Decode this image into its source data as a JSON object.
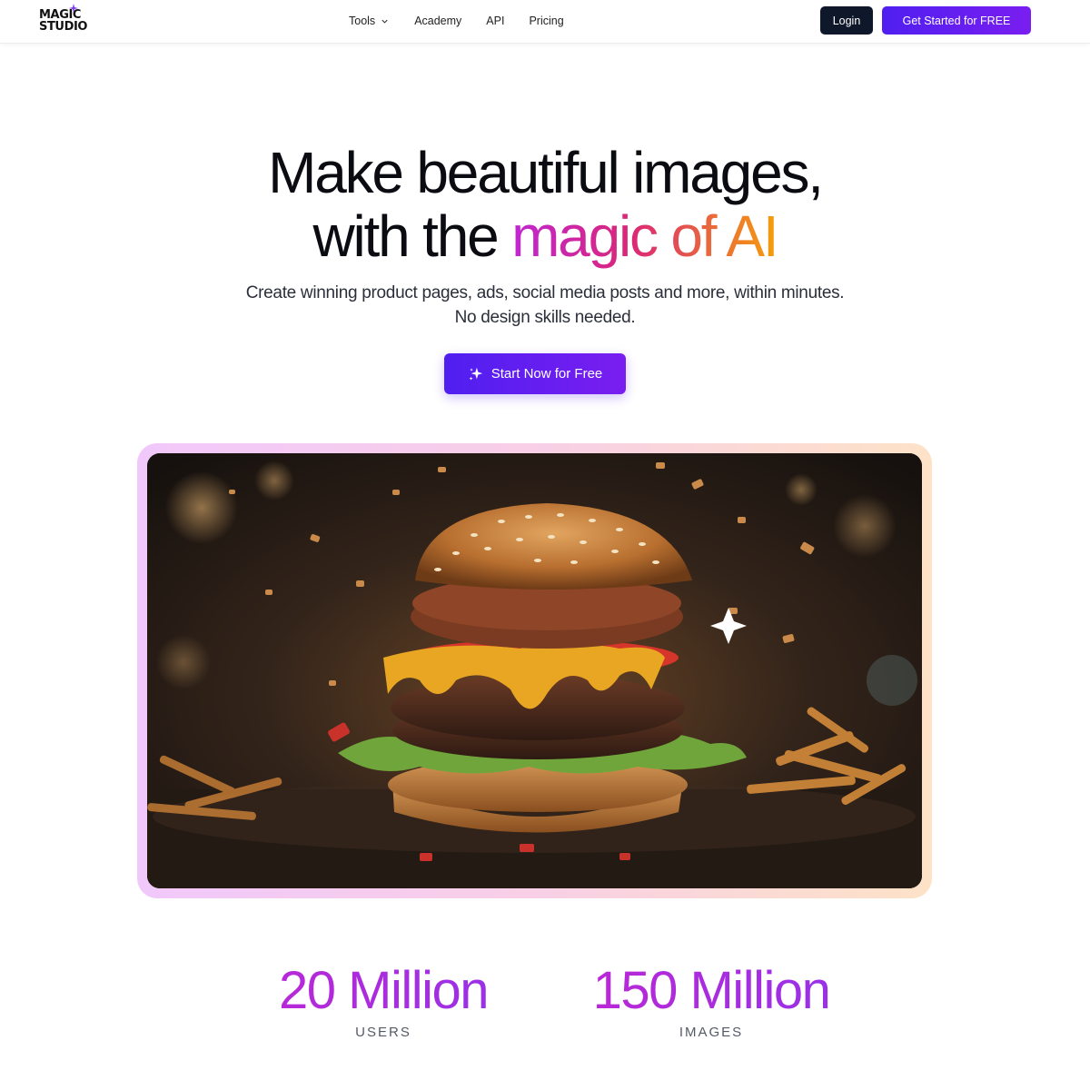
{
  "brand": {
    "logo_line1": "MAGIC",
    "logo_line2": "STUDIO",
    "accent": "#7c3aed"
  },
  "nav": {
    "items": [
      {
        "label": "Tools",
        "has_dropdown": true
      },
      {
        "label": "Academy"
      },
      {
        "label": "API"
      },
      {
        "label": "Pricing"
      }
    ],
    "login_label": "Login",
    "get_started_label": "Get Started for FREE"
  },
  "hero": {
    "title_line1": "Make beautiful images,",
    "title_line2_plain": "with the ",
    "title_line2_accent": "magic of AI",
    "subtitle_line1": "Create winning product pages, ads, social media posts and more, within minutes.",
    "subtitle_line2": "No design skills needed.",
    "cta_label": "Start Now for Free",
    "cta_icon": "sparkle-icon",
    "image_subject": "gourmet burger with flying crumbs"
  },
  "stats": [
    {
      "value": "20 Million",
      "label": "USERS"
    },
    {
      "value": "150 Million",
      "label": "IMAGES"
    }
  ],
  "colors": {
    "primary_button": "#5b1ff0",
    "dark_button": "#0f172a",
    "gradient_start": "#c026d3",
    "gradient_end": "#f59e0b"
  }
}
